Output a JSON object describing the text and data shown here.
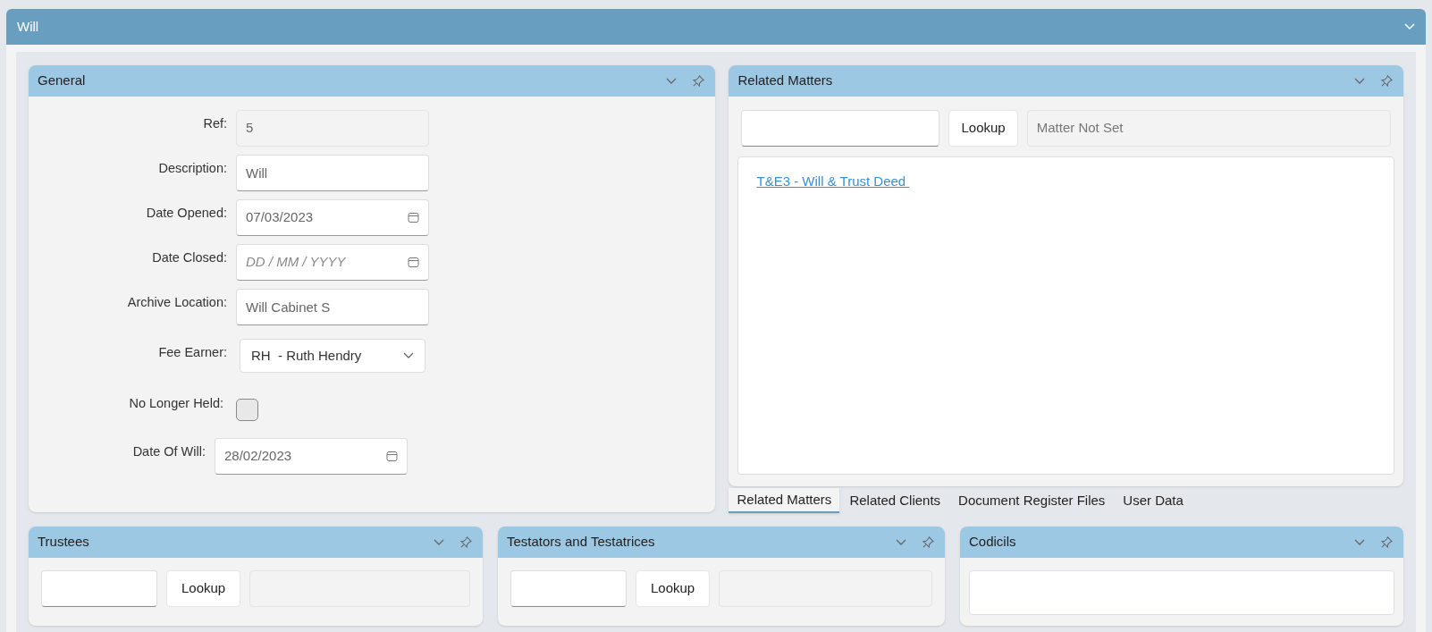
{
  "window": {
    "title": "Will",
    "collapsed": false
  },
  "general": {
    "title": "General",
    "fields": [
      {
        "label": "Ref:",
        "kind": "readonly",
        "value": "5"
      },
      {
        "label": "Description:",
        "kind": "text",
        "value": "Will"
      },
      {
        "label": "Date Opened:",
        "kind": "date",
        "value": "07/03/2023"
      },
      {
        "label": "Date Closed:",
        "kind": "date",
        "placeholder": "DD / MM / YYYY"
      },
      {
        "label": "Archive Location:",
        "kind": "text",
        "value": "Will Cabinet S"
      },
      {
        "label": "Fee Earner:",
        "kind": "select",
        "value": "RH  - Ruth Hendry"
      },
      {
        "label": "No Longer Held:",
        "kind": "checkbox",
        "checked": false
      },
      {
        "label": "Date Of Will:",
        "kind": "date",
        "value": "28/02/2023"
      }
    ]
  },
  "related": {
    "title": "Related Matters",
    "button": "Lookup",
    "display": "Matter Not Set",
    "links": [
      "T&E3 - Will & Trust Deed "
    ],
    "tabs": [
      {
        "label": "Related Matters",
        "selected": true
      },
      {
        "label": "Related Clients",
        "selected": false
      },
      {
        "label": "Document Register Files",
        "selected": false
      },
      {
        "label": "User Data",
        "selected": false
      }
    ]
  },
  "bottom_panels": [
    {
      "title": "Trustees",
      "kind": "lookup",
      "button": "Lookup"
    },
    {
      "title": "Testators and Testatrices",
      "kind": "lookup",
      "button": "Lookup"
    },
    {
      "title": "Codicils",
      "kind": "list"
    }
  ]
}
